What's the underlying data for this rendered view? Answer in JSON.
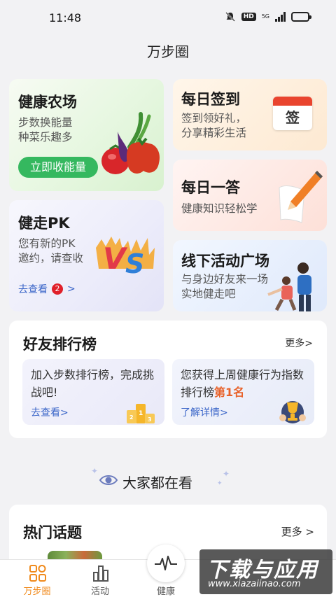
{
  "status_bar": {
    "time": "11:48",
    "hd": "HD",
    "network": "5G"
  },
  "header": {
    "title": "万步圈"
  },
  "cards": {
    "farm": {
      "title": "健康农场",
      "line1": "步数换能量",
      "line2": "种菜乐趣多",
      "button": "立即收能量"
    },
    "pk": {
      "title": "健走PK",
      "line1": "您有新的PK",
      "line2": "邀约，请查收",
      "link": "去查看",
      "badge": "2",
      "arrow": ">"
    },
    "signin": {
      "title": "每日签到",
      "line1": "签到领好礼，",
      "line2": "分享精彩生活",
      "calendar_text": "签"
    },
    "quiz": {
      "title": "每日一答",
      "line1": "健康知识轻松学"
    },
    "offline": {
      "title": "线下活动广场",
      "line1": "与身边好友来一场",
      "line2": "实地健走吧"
    }
  },
  "ranking": {
    "title": "好友排行榜",
    "more": "更多>",
    "left": {
      "text": "加入步数排行榜，完成挑战吧!",
      "link": "去查看>"
    },
    "right": {
      "text_before": "您获得上周健康行为指数排行榜",
      "highlight": "第1名",
      "link": "了解详情>"
    }
  },
  "watching": {
    "label": "大家都在看"
  },
  "topics": {
    "title": "热门话题",
    "more": "更多 >"
  },
  "tabs": [
    {
      "label": "万步圈",
      "icon": "home-grid-icon",
      "active": true
    },
    {
      "label": "活动",
      "icon": "activity-chart-icon",
      "active": false
    },
    {
      "label": "健康",
      "icon": "heartbeat-icon",
      "active": false
    }
  ],
  "watermark": {
    "title": "下载与应用",
    "url": "www.xiazaiinao.com"
  },
  "colors": {
    "accent": "#f08a1c",
    "green": "#35b85f",
    "link": "#3a65c8",
    "badge": "#e0202a",
    "highlight": "#e8622a"
  }
}
